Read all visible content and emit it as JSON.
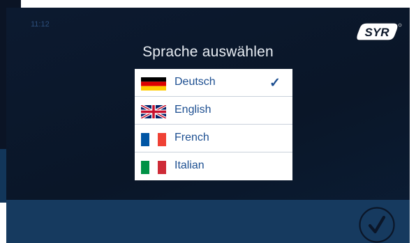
{
  "status": {
    "time": "11:12"
  },
  "brand": {
    "logo_text": "SYR"
  },
  "dialog": {
    "title": "Sprache auswählen",
    "languages": [
      {
        "label": "Deutsch",
        "flag": "flag-germany",
        "selected": true
      },
      {
        "label": "English",
        "flag": "flag-uk",
        "selected": false
      },
      {
        "label": "French",
        "flag": "flag-france",
        "selected": false
      },
      {
        "label": "Italian",
        "flag": "flag-italy",
        "selected": false
      }
    ],
    "selected_mark": "✓"
  },
  "colors": {
    "accent": "#1d4f91",
    "background": "#0a1628",
    "bottom_bar": "#163a5f"
  }
}
